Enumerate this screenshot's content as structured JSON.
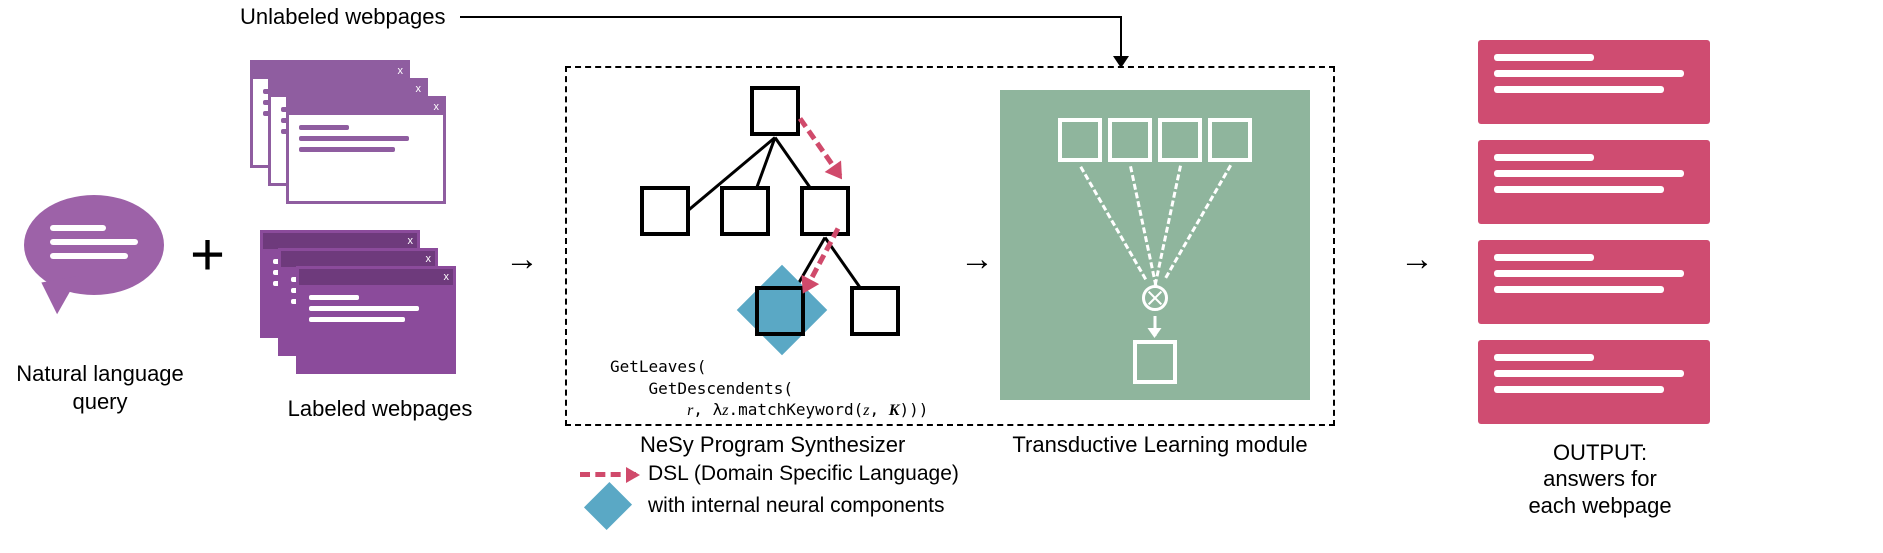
{
  "top_label": "Unlabeled webpages",
  "nl_query_label": "Natural language query",
  "labeled_label": "Labeled webpages",
  "code": {
    "line1": "GetLeaves(",
    "line2": "    GetDescendents(",
    "line3_prefix": "        ",
    "line3_r": "r",
    "line3_mid": ", λ",
    "line3_z": "z",
    "line3_match": ".matchKeyword(",
    "line3_z2": "z",
    "line3_comma": ", ",
    "line3_K": "K",
    "line3_end": ")))"
  },
  "center": {
    "nesy": "NeSy Program Synthesizer",
    "trans": "Transductive Learning module",
    "dsl": "DSL (Domain Specific Language)",
    "neural": "with internal neural components"
  },
  "output_label": "OUTPUT:\nanswers for\neach webpage"
}
